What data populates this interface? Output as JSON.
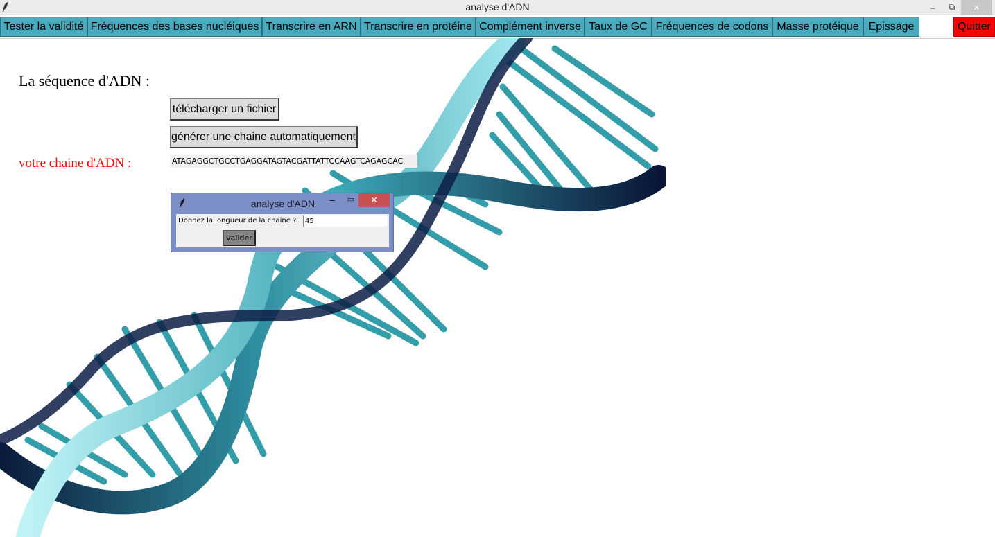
{
  "window": {
    "title": "analyse d'ADN",
    "minimize_glyph": "–",
    "maximize_glyph": "⧉",
    "close_glyph": "✕"
  },
  "menu": {
    "items": [
      "Tester  la validité",
      "Fréquences des bases nucléiques",
      "Transcrire en ARN",
      "Transcrire en protéine",
      "Complément inverse",
      "Taux de GC",
      "Fréquences de codons",
      "Masse protéique",
      "Epissage"
    ],
    "quit_label": "Quitter",
    "button_color": "#49a9bd",
    "quit_color": "#ff0000"
  },
  "main": {
    "sequence_heading": "La séquence d'ADN :",
    "upload_button": "télécharger un fichier",
    "generate_button": "générer une chaine automatiquement",
    "chain_label": "votre chaine d'ADN :",
    "chain_value": "ATAGAGGCTGCCTGAGGATAGTACGATTATTCCAAGTCAGAGCAC"
  },
  "dialog": {
    "title": "analyse d'ADN",
    "minimize_glyph": "–",
    "maximize_glyph": "▭",
    "close_glyph": "✕",
    "prompt": "Donnez la longueur de la chaine ?",
    "input_value": "45",
    "submit_label": "valider"
  },
  "icons": {
    "app": "feather-icon",
    "dna": "dna-helix-image"
  }
}
